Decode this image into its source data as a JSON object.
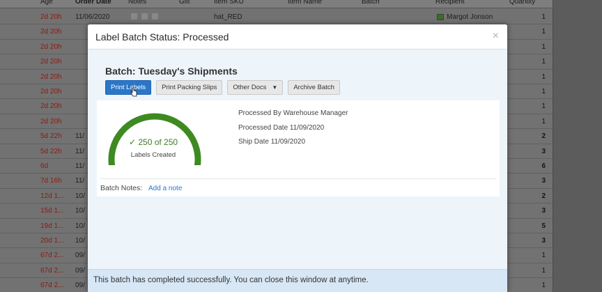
{
  "grid": {
    "headers": [
      "Age",
      "Order Date",
      "Notes",
      "Gift",
      "Item SKU",
      "Item Name",
      "Batch",
      "Recipient",
      "Quantity"
    ],
    "first_row": {
      "sku": "hat_RED",
      "recipient": "Margot Jonson",
      "date": "11/06/2020"
    },
    "rows": [
      {
        "age": "2d 20h",
        "date": "11/06/2020",
        "qty": "1",
        "bold": false
      },
      {
        "age": "2d 20h",
        "date": "",
        "qty": "1",
        "bold": false
      },
      {
        "age": "2d 20h",
        "date": "",
        "qty": "1",
        "bold": false
      },
      {
        "age": "2d 20h",
        "date": "",
        "qty": "1",
        "bold": false
      },
      {
        "age": "2d 20h",
        "date": "",
        "qty": "1",
        "bold": false
      },
      {
        "age": "2d 20h",
        "date": "",
        "qty": "1",
        "bold": false
      },
      {
        "age": "2d 20h",
        "date": "",
        "qty": "1",
        "bold": false
      },
      {
        "age": "2d 20h",
        "date": "",
        "qty": "1",
        "bold": false
      },
      {
        "age": "5d 22h",
        "date": "11/",
        "qty": "2",
        "bold": true
      },
      {
        "age": "5d 22h",
        "date": "11/",
        "qty": "3",
        "bold": true
      },
      {
        "age": "6d",
        "date": "11/",
        "qty": "6",
        "bold": true
      },
      {
        "age": "7d 16h",
        "date": "11/",
        "qty": "3",
        "bold": true
      },
      {
        "age": "12d 1...",
        "date": "10/",
        "qty": "2",
        "bold": true
      },
      {
        "age": "15d 1...",
        "date": "10/",
        "qty": "3",
        "bold": true
      },
      {
        "age": "19d 1...",
        "date": "10/",
        "qty": "5",
        "bold": true
      },
      {
        "age": "20d 1...",
        "date": "10/",
        "qty": "3",
        "bold": true
      },
      {
        "age": "67d 2...",
        "date": "09/",
        "qty": "1",
        "bold": false
      },
      {
        "age": "67d 2...",
        "date": "09/",
        "qty": "1",
        "bold": false
      },
      {
        "age": "67d 2...",
        "date": "09/",
        "qty": "1",
        "bold": false
      }
    ]
  },
  "modal": {
    "title": "Label Batch Status: Processed",
    "close": "×",
    "batch_title": "Batch: Tuesday's Shipments",
    "buttons": {
      "print_labels": "Print Labels",
      "print_packing_slips": "Print Packing Slips",
      "other_docs": "Other Docs",
      "archive_batch": "Archive Batch"
    },
    "gauge": {
      "value_text": "250 of 250",
      "label": "Labels Created",
      "fraction": 1.0,
      "color": "#3e8a22"
    },
    "info": {
      "processed_by": "Processed By Warehouse Manager",
      "processed_date": "Processed Date 11/09/2020",
      "ship_date": "Ship Date 11/09/2020"
    },
    "batch_notes_label": "Batch Notes:",
    "add_note_link": "Add a note",
    "footer": "This batch has completed successfully. You can close this window at anytime."
  },
  "colors": {
    "accent": "#2b76c9",
    "success": "#3e8a22"
  }
}
